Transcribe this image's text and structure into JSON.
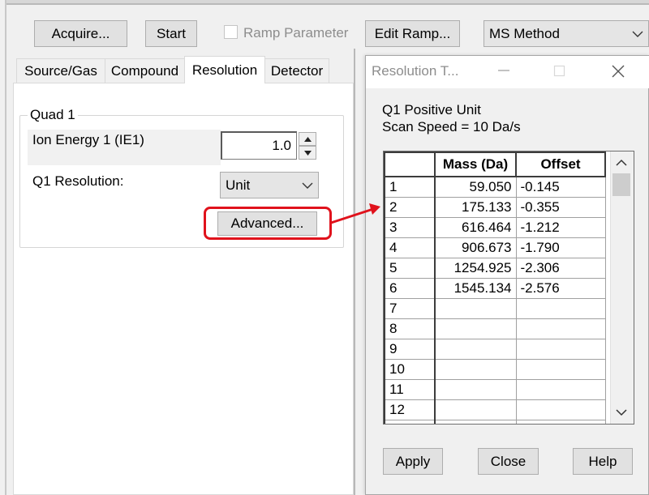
{
  "toolbar": {
    "acquire_label": "Acquire...",
    "start_label": "Start",
    "ramp_parameter_label": "Ramp Parameter",
    "edit_ramp_label": "Edit Ramp...",
    "method_select_value": "MS Method"
  },
  "tabs": [
    {
      "label": "Source/Gas"
    },
    {
      "label": "Compound"
    },
    {
      "label": "Resolution"
    },
    {
      "label": "Detector"
    }
  ],
  "quad_group": {
    "title": "Quad 1",
    "ion_energy_label": "Ion Energy 1 (IE1)",
    "ion_energy_value": "1.0",
    "q1_resolution_label": "Q1 Resolution:",
    "q1_resolution_value": "Unit",
    "advanced_label": "Advanced..."
  },
  "dialog": {
    "title": "Resolution T...",
    "info_line1": "Q1 Positive Unit",
    "info_line2": "Scan Speed = 10 Da/s",
    "columns": [
      "Mass (Da)",
      "Offset"
    ],
    "rows": [
      {
        "n": "1",
        "mass": "59.050",
        "offset": "-0.145"
      },
      {
        "n": "2",
        "mass": "175.133",
        "offset": "-0.355"
      },
      {
        "n": "3",
        "mass": "616.464",
        "offset": "-1.212"
      },
      {
        "n": "4",
        "mass": "906.673",
        "offset": "-1.790"
      },
      {
        "n": "5",
        "mass": "1254.925",
        "offset": "-2.306"
      },
      {
        "n": "6",
        "mass": "1545.134",
        "offset": "-2.576"
      },
      {
        "n": "7",
        "mass": "",
        "offset": ""
      },
      {
        "n": "8",
        "mass": "",
        "offset": ""
      },
      {
        "n": "9",
        "mass": "",
        "offset": ""
      },
      {
        "n": "10",
        "mass": "",
        "offset": ""
      },
      {
        "n": "11",
        "mass": "",
        "offset": ""
      },
      {
        "n": "12",
        "mass": "",
        "offset": ""
      },
      {
        "n": "",
        "mass": "",
        "offset": ""
      }
    ],
    "apply_label": "Apply",
    "close_label": "Close",
    "help_label": "Help"
  },
  "colors": {
    "highlight": "#e0121c",
    "arrow": "#e0121c"
  },
  "icons": {
    "minimize": "minimize-icon",
    "maximize": "maximize-icon",
    "close": "close-icon",
    "dropdown": "chevron-down-icon",
    "spin_up": "spin-up-icon",
    "spin_down": "spin-down-icon",
    "scroll_up": "scroll-up-icon",
    "scroll_down": "scroll-down-icon"
  }
}
